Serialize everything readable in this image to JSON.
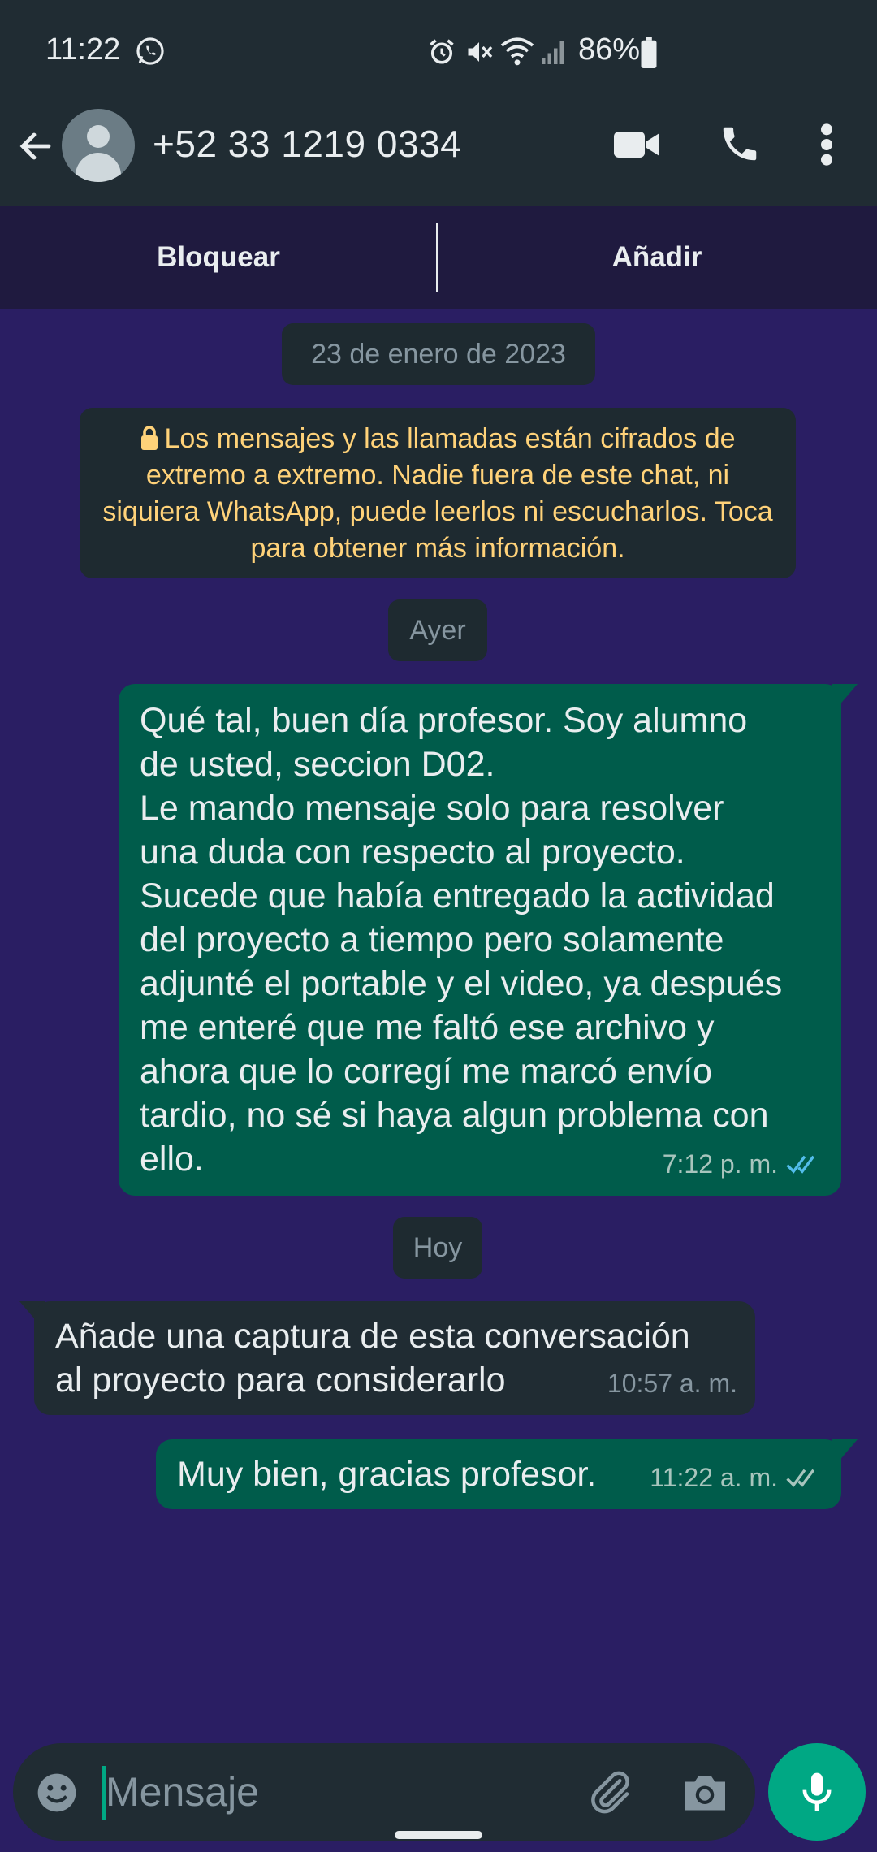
{
  "status_bar": {
    "time": "11:22",
    "battery": "86%"
  },
  "header": {
    "title": "+52 33 1219 0334"
  },
  "action_bar": {
    "block_label": "Bloquear",
    "add_label": "Añadir"
  },
  "chips": {
    "date1": "23 de enero de 2023",
    "date2": "Ayer",
    "date3": "Hoy"
  },
  "encryption_notice": "Los mensajes y las llamadas están cifrados de extremo a extremo. Nadie fuera de este chat, ni siquiera WhatsApp, puede leerlos ni escucharlos. Toca para obtener más información.",
  "messages": [
    {
      "direction": "outgoing",
      "text": "Qué tal, buen día profesor. Soy alumno\nde usted, seccion D02.\nLe mando mensaje solo para resolver\nuna duda con respecto al proyecto.\nSucede que había entregado la actividad\ndel proyecto a tiempo pero solamente\nadjunté el portable y el video, ya después\nme enteré que me faltó ese archivo y\nahora que lo corregí me marcó envío\ntardio, no sé si haya algun problema con\nello.",
      "time": "7:12 p. m.",
      "status": "read"
    },
    {
      "direction": "incoming",
      "text": "Añade una captura de esta conversación\nal proyecto para considerarlo",
      "time": "10:57 a. m."
    },
    {
      "direction": "outgoing",
      "text": "Muy bien, gracias profesor.",
      "time": "11:22 a. m.",
      "status": "delivered"
    }
  ],
  "input": {
    "placeholder": "Mensaje"
  },
  "colors": {
    "header_bg": "#202c33",
    "chat_bg": "#2a1e63",
    "outgoing_bubble": "#005c4b",
    "incoming_bubble": "#202c33",
    "accent": "#00a884",
    "encryption_text": "#ffd279",
    "read_ticks": "#53bdeb"
  },
  "icons": [
    "whatsapp-icon",
    "alarm-icon",
    "mute-icon",
    "wifi-icon",
    "signal-icon",
    "battery-icon",
    "back-arrow-icon",
    "avatar-icon",
    "video-call-icon",
    "phone-icon",
    "more-vert-icon",
    "lock-icon",
    "double-check-icon",
    "emoji-icon",
    "attach-icon",
    "camera-icon",
    "mic-icon"
  ]
}
